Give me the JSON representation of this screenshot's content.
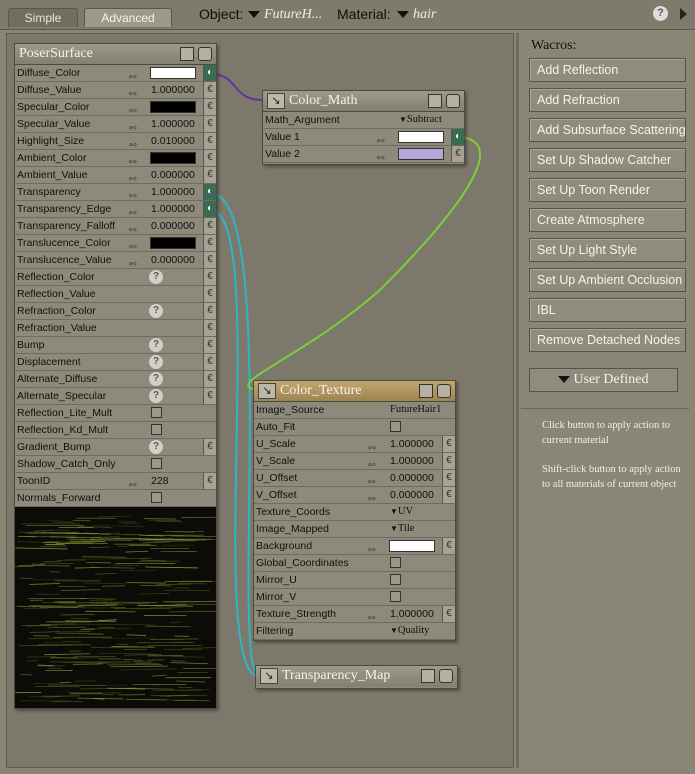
{
  "tabs": {
    "simple": "Simple",
    "advanced": "Advanced"
  },
  "header": {
    "object_label": "Object:",
    "object_value": "FutureH...",
    "material_label": "Material:",
    "material_value": "hair"
  },
  "poser_surface": {
    "title": "PoserSurface",
    "rows": [
      {
        "label": "Diffuse_Color",
        "type": "color",
        "color": "#ffffff",
        "plug": "green"
      },
      {
        "label": "Diffuse_Value",
        "type": "value",
        "value": "1.000000"
      },
      {
        "label": "Specular_Color",
        "type": "color",
        "color": "#000000"
      },
      {
        "label": "Specular_Value",
        "type": "value",
        "value": "1.000000"
      },
      {
        "label": "Highlight_Size",
        "type": "value",
        "value": "0.010000"
      },
      {
        "label": "Ambient_Color",
        "type": "color",
        "color": "#000000"
      },
      {
        "label": "Ambient_Value",
        "type": "value",
        "value": "0.000000"
      },
      {
        "label": "Transparency",
        "type": "value",
        "value": "1.000000",
        "plug": "green"
      },
      {
        "label": "Transparency_Edge",
        "type": "value",
        "value": "1.000000",
        "plug": "green"
      },
      {
        "label": "Transparency_Falloff",
        "type": "value",
        "value": "0.000000"
      },
      {
        "label": "Translucence_Color",
        "type": "color",
        "color": "#000000"
      },
      {
        "label": "Translucence_Value",
        "type": "value",
        "value": "0.000000"
      },
      {
        "label": "Reflection_Color",
        "type": "help"
      },
      {
        "label": "Reflection_Value",
        "type": "plain"
      },
      {
        "label": "Refraction_Color",
        "type": "help"
      },
      {
        "label": "Refraction_Value",
        "type": "plain"
      },
      {
        "label": "Bump",
        "type": "help"
      },
      {
        "label": "Displacement",
        "type": "help"
      },
      {
        "label": "Alternate_Diffuse",
        "type": "help"
      },
      {
        "label": "Alternate_Specular",
        "type": "help"
      },
      {
        "label": "Reflection_Lite_Mult",
        "type": "check"
      },
      {
        "label": "Reflection_Kd_Mult",
        "type": "check"
      },
      {
        "label": "Gradient_Bump",
        "type": "help"
      },
      {
        "label": "Shadow_Catch_Only",
        "type": "check"
      },
      {
        "label": "ToonID",
        "type": "value",
        "value": "228"
      },
      {
        "label": "Normals_Forward",
        "type": "check"
      }
    ]
  },
  "color_math": {
    "title": "Color_Math",
    "rows": [
      {
        "label": "Math_Argument",
        "type": "dropdown",
        "value": "Subtract"
      },
      {
        "label": "Value 1",
        "type": "color",
        "color": "#ffffff",
        "plug": "green"
      },
      {
        "label": "Value 2",
        "type": "color",
        "color": "#b8a6d8"
      }
    ]
  },
  "color_texture": {
    "title": "Color_Texture",
    "rows": [
      {
        "label": "Image_Source",
        "type": "text",
        "value": "FutureHair1"
      },
      {
        "label": "Auto_Fit",
        "type": "check"
      },
      {
        "label": "U_Scale",
        "type": "value",
        "value": "1.000000"
      },
      {
        "label": "V_Scale",
        "type": "value",
        "value": "1.000000"
      },
      {
        "label": "U_Offset",
        "type": "value",
        "value": "0.000000"
      },
      {
        "label": "V_Offset",
        "type": "value",
        "value": "0.000000"
      },
      {
        "label": "Texture_Coords",
        "type": "dropdown",
        "value": "UV"
      },
      {
        "label": "Image_Mapped",
        "type": "dropdown",
        "value": "Tile"
      },
      {
        "label": "Background",
        "type": "color",
        "color": "#ffffff"
      },
      {
        "label": "Global_Coordinates",
        "type": "check"
      },
      {
        "label": "Mirror_U",
        "type": "check"
      },
      {
        "label": "Mirror_V",
        "type": "check"
      },
      {
        "label": "Texture_Strength",
        "type": "value",
        "value": "1.000000"
      },
      {
        "label": "Filtering",
        "type": "dropdown",
        "value": "Quality"
      }
    ]
  },
  "transparency_map": {
    "title": "Transparency_Map"
  },
  "wacros": {
    "title": "Wacros:",
    "buttons": [
      "Add Reflection",
      "Add Refraction",
      "Add Subsurface Scattering",
      "Set Up Shadow Catcher",
      "Set Up Toon Render",
      "Create Atmosphere",
      "Set Up Light Style",
      "Set Up Ambient Occlusion",
      "IBL",
      "Remove Detached Nodes"
    ],
    "user_defined": "User Defined",
    "help1": "Click button to apply action to current material",
    "help2": "Shift-click button to apply action to all materials of current object"
  },
  "colors": {
    "wire_purple": "#6a2ca8",
    "wire_cyan": "#2fb6c4",
    "wire_green": "#7ccf3a"
  }
}
